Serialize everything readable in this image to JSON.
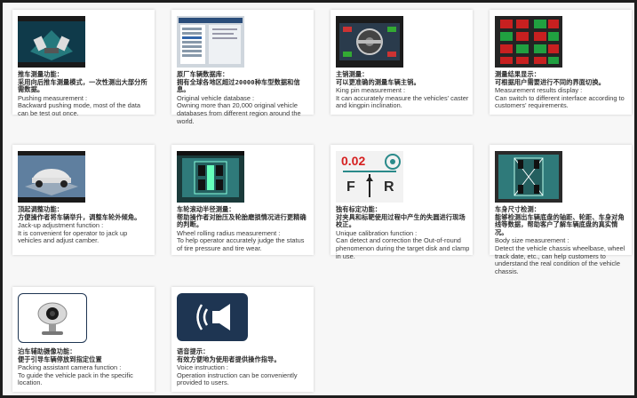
{
  "features": [
    {
      "cn": "推车测量功能：\n采用向后推车测量模式，一次性测出大部分所需数据。",
      "en_title": "Pushing measurement :",
      "en_desc": "Backward pushing mode, most of the data can be test out once."
    },
    {
      "cn": "原厂车辆数据库：\n拥有全球各地区超过20000种车型数据和信息。",
      "en_title": "Original vehicle database :",
      "en_desc": "Owning more than 20,000 original vehicle databases from different region around the world."
    },
    {
      "cn": "主销测量：\n可以更准确的测量车辆主销。",
      "en_title": "King pin measurement :",
      "en_desc": "It can accurately measure the vehicles' caster and kingpin inclination."
    },
    {
      "cn": "测量结果显示：\n可根据用户需要进行不同的界面切换。",
      "en_title": "Measurement results display :",
      "en_desc": "Can switch to different interface according to customers' requirements."
    },
    {
      "cn": "顶起调整功能：\n方便操作者将车辆举升，调整车轮外倾角。",
      "en_title": "Jack-up adjustment function :",
      "en_desc": "It is convenient for operator to jack up vehicles and adjust camber."
    },
    {
      "cn": "车轮滚动半径测量：\n帮助操作者对胎压及轮胎磨损情况进行更精确的判断。",
      "en_title": "Wheel rolling radius measurement :",
      "en_desc": "To help operator accurately judge the status of tire pressure and tire wear."
    },
    {
      "cn": "独有标定功能：\n对夹具和标靶使用过程中产生的失圆进行现场校正。",
      "en_title": "Unique calibration function :",
      "en_desc": "Can detect and correction the Out-of-round phenomenon during the target disk and clamp in use."
    },
    {
      "cn": "车身尺寸检测：\n能够检测出车辆底盘的轴距、轮距、车身对角线等数据，帮助客户了解车辆底盘的真实情况。",
      "en_title": "Body size measurement :",
      "en_desc": "Detect the vehicle chassis wheelbase, wheel track date, etc., can help customers to understand the real condition of the vehicle chassis."
    },
    {
      "cn": "泊车辅助摄像功能：\n便于引导车辆停放到指定位置",
      "en_title": "Packing assistant camera function :",
      "en_desc": "To guide the vehicle pack in the specific location."
    },
    {
      "cn": "语音提示：\n有效方便地为使用者提供操作指导。",
      "en_title": "Voice instruction :",
      "en_desc": "Operation instruction can be conveniently provided to users."
    }
  ],
  "calibration_thumb": {
    "value": "0.02",
    "left_letter": "F",
    "right_letter": "R"
  },
  "colors": {
    "screen_dark": "#1d2a3a",
    "screen_blue": "#2a5d8f",
    "teal": "#2a8a8a",
    "red_value": "#d61f1f",
    "voice_bg": "#1e3552"
  }
}
